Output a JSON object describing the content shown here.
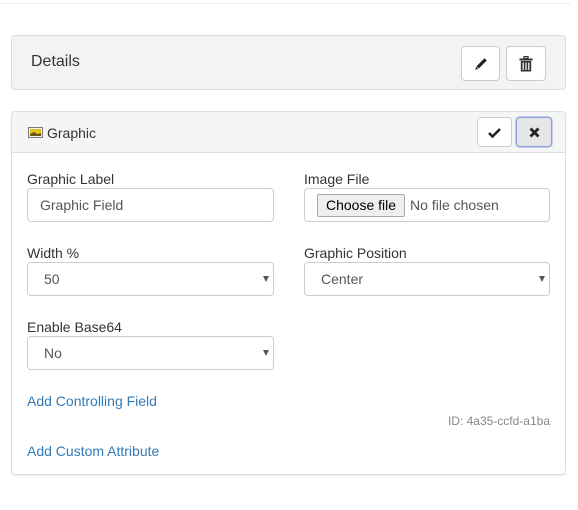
{
  "details_panel": {
    "title": "Details",
    "edit_button": {
      "icon": "pencil-icon"
    },
    "delete_button": {
      "icon": "trash-icon"
    }
  },
  "graphic_panel": {
    "title": "Graphic",
    "header_icon": "image-icon",
    "save_button": {
      "icon": "checkmark-icon"
    },
    "cancel_button": {
      "icon": "close-icon"
    },
    "fields": {
      "graphic_label": {
        "label": "Graphic Label",
        "value": "Graphic Field"
      },
      "image_file": {
        "label": "Image File",
        "button_label": "Choose file",
        "status": "No file chosen"
      },
      "width": {
        "label": "Width %",
        "selected": "50"
      },
      "graphic_position": {
        "label": "Graphic Position",
        "selected": "Center"
      },
      "enable_base64": {
        "label": "Enable Base64",
        "selected": "No"
      }
    },
    "links": {
      "add_controlling_field": "Add Controlling Field",
      "add_custom_attribute": "Add Custom Attribute"
    },
    "field_id": "ID: 4a35-ccfd-a1ba"
  },
  "colors": {
    "link": "#337ab7",
    "panel_bg": "#f3f3f3",
    "border": "#dddddd"
  }
}
